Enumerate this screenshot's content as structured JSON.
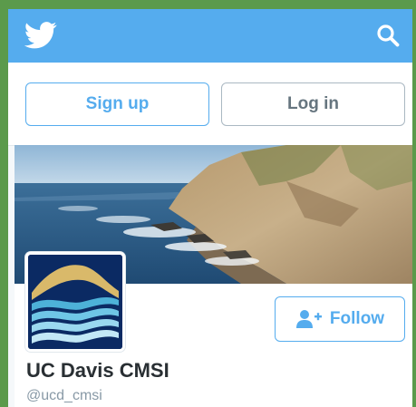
{
  "header": {
    "logo_icon": "twitter-bird-icon",
    "search_icon": "search-icon",
    "background_color": "#55acee"
  },
  "auth": {
    "signup_label": "Sign up",
    "login_label": "Log in"
  },
  "profile": {
    "name": "UC Davis CMSI",
    "handle": "@ucd_cmsi",
    "follow_label": "Follow",
    "follow_icon": "add-user-icon",
    "banner": "coastline-photo",
    "avatar": "cmsi-wave-logo"
  },
  "colors": {
    "accent": "#55acee",
    "text_primary": "#292f33",
    "text_secondary": "#8899a6",
    "outer_frame": "#5b9a4b"
  }
}
